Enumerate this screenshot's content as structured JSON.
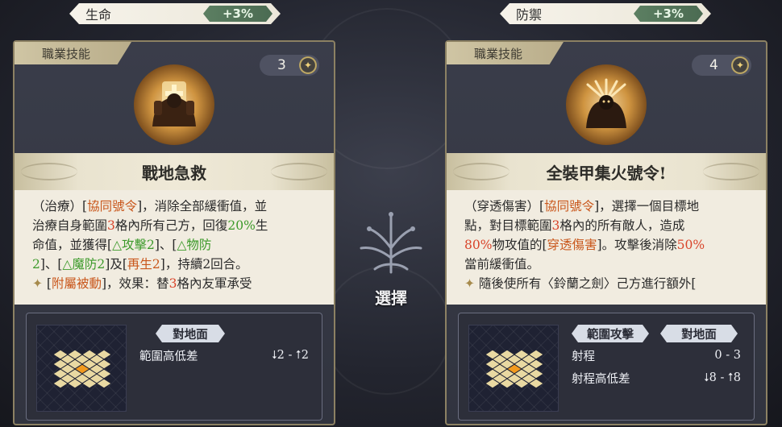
{
  "left": {
    "stat": {
      "name": "生命",
      "value": "+3%"
    },
    "card_label": "職業技能",
    "cost": "3",
    "skill_title": "戰地急救",
    "desc_lines": [
      [
        {
          "t": "（治療）[",
          "c": ""
        },
        {
          "t": "協同號令",
          "c": "t-orange"
        },
        {
          "t": "]，消除全部緩衝值，並",
          "c": ""
        }
      ],
      [
        {
          "t": "治療自身範圍",
          "c": ""
        },
        {
          "t": "3",
          "c": "t-red"
        },
        {
          "t": "格內所有己方，回復",
          "c": ""
        },
        {
          "t": "20%",
          "c": "t-green"
        },
        {
          "t": "生",
          "c": ""
        }
      ],
      [
        {
          "t": "命值，並獲得[",
          "c": ""
        },
        {
          "t": "△攻擊2",
          "c": "t-green"
        },
        {
          "t": "]、[",
          "c": ""
        },
        {
          "t": "△物防",
          "c": "t-green"
        }
      ],
      [
        {
          "t": "2",
          "c": "t-green"
        },
        {
          "t": "]、[",
          "c": ""
        },
        {
          "t": "△魔防2",
          "c": "t-green"
        },
        {
          "t": "]及[",
          "c": ""
        },
        {
          "t": "再生2",
          "c": "t-orange"
        },
        {
          "t": "]，持續2回合。",
          "c": ""
        }
      ],
      [
        {
          "t": "✦ ",
          "c": "diamond"
        },
        {
          "t": "[",
          "c": ""
        },
        {
          "t": "附屬被動",
          "c": "t-orange"
        },
        {
          "t": "]，效果：替",
          "c": ""
        },
        {
          "t": "3",
          "c": "t-red"
        },
        {
          "t": "格內友軍承受",
          "c": ""
        }
      ]
    ],
    "tags": [
      "對地面"
    ],
    "stats": [
      {
        "label": "範圍高低差",
        "value": "⭣2 - ⭡2"
      }
    ]
  },
  "right": {
    "stat": {
      "name": "防禦",
      "value": "+3%"
    },
    "card_label": "職業技能",
    "cost": "4",
    "skill_title": "全裝甲集火號令!",
    "desc_lines": [
      [
        {
          "t": "（穿透傷害）[",
          "c": ""
        },
        {
          "t": "協同號令",
          "c": "t-orange"
        },
        {
          "t": "]，選擇一個目標地",
          "c": ""
        }
      ],
      [
        {
          "t": "點，對目標範圍",
          "c": ""
        },
        {
          "t": "3",
          "c": "t-red"
        },
        {
          "t": "格內的所有敵人，造成",
          "c": ""
        }
      ],
      [
        {
          "t": "80%",
          "c": "t-red"
        },
        {
          "t": "物攻值的[",
          "c": ""
        },
        {
          "t": "穿透傷害",
          "c": "t-orange"
        },
        {
          "t": "]。攻擊後消除",
          "c": ""
        },
        {
          "t": "50%",
          "c": "t-red"
        }
      ],
      [
        {
          "t": "當前緩衝值。",
          "c": ""
        }
      ],
      [
        {
          "t": "✦ ",
          "c": "diamond"
        },
        {
          "t": "隨後使所有〈鈴蘭之劍〉己方進行額外[",
          "c": ""
        }
      ]
    ],
    "tags": [
      "範圍攻擊",
      "對地面"
    ],
    "stats": [
      {
        "label": "射程",
        "value": "0 - 3"
      },
      {
        "label": "射程高低差",
        "value": "⭣8 - ⭡8"
      }
    ]
  },
  "center": {
    "select_label": "選擇"
  },
  "colors": {
    "accent_gold": "#c9b26a",
    "stat_green": "#4b6b52",
    "text_orange": "#c9571c"
  },
  "icons": {
    "cost": "star-icon",
    "left_skill": "shield-knight-icon",
    "right_skill": "armored-commander-icon",
    "select": "tree-emblem-icon"
  }
}
